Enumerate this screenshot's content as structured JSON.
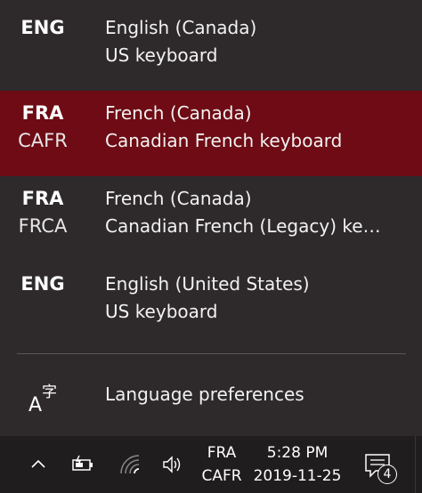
{
  "languages": [
    {
      "code": "ENG",
      "subcode": "",
      "name": "English (Canada)",
      "keyboard": "US keyboard",
      "selected": false
    },
    {
      "code": "FRA",
      "subcode": "CAFR",
      "name": "French (Canada)",
      "keyboard": "Canadian French keyboard",
      "selected": true
    },
    {
      "code": "FRA",
      "subcode": "FRCA",
      "name": "French (Canada)",
      "keyboard": "Canadian French (Legacy) keyboard",
      "selected": false
    },
    {
      "code": "ENG",
      "subcode": "",
      "name": "English (United States)",
      "keyboard": "US keyboard",
      "selected": false
    }
  ],
  "preferences": {
    "label": "Language preferences",
    "icon": "language-settings-icon"
  },
  "taskbar": {
    "lang_code": "FRA",
    "lang_subcode": "CAFR",
    "time": "5:28 PM",
    "date": "2019-11-25",
    "notification_count": "4",
    "icons": [
      "chevron-up-icon",
      "battery-charging-icon",
      "wifi-icon",
      "volume-icon",
      "action-center-icon"
    ]
  },
  "colors": {
    "flyout_bg": "#2e2a2c",
    "selected_bg": "#6e0b14",
    "taskbar_bg": "#1f1d1e"
  }
}
